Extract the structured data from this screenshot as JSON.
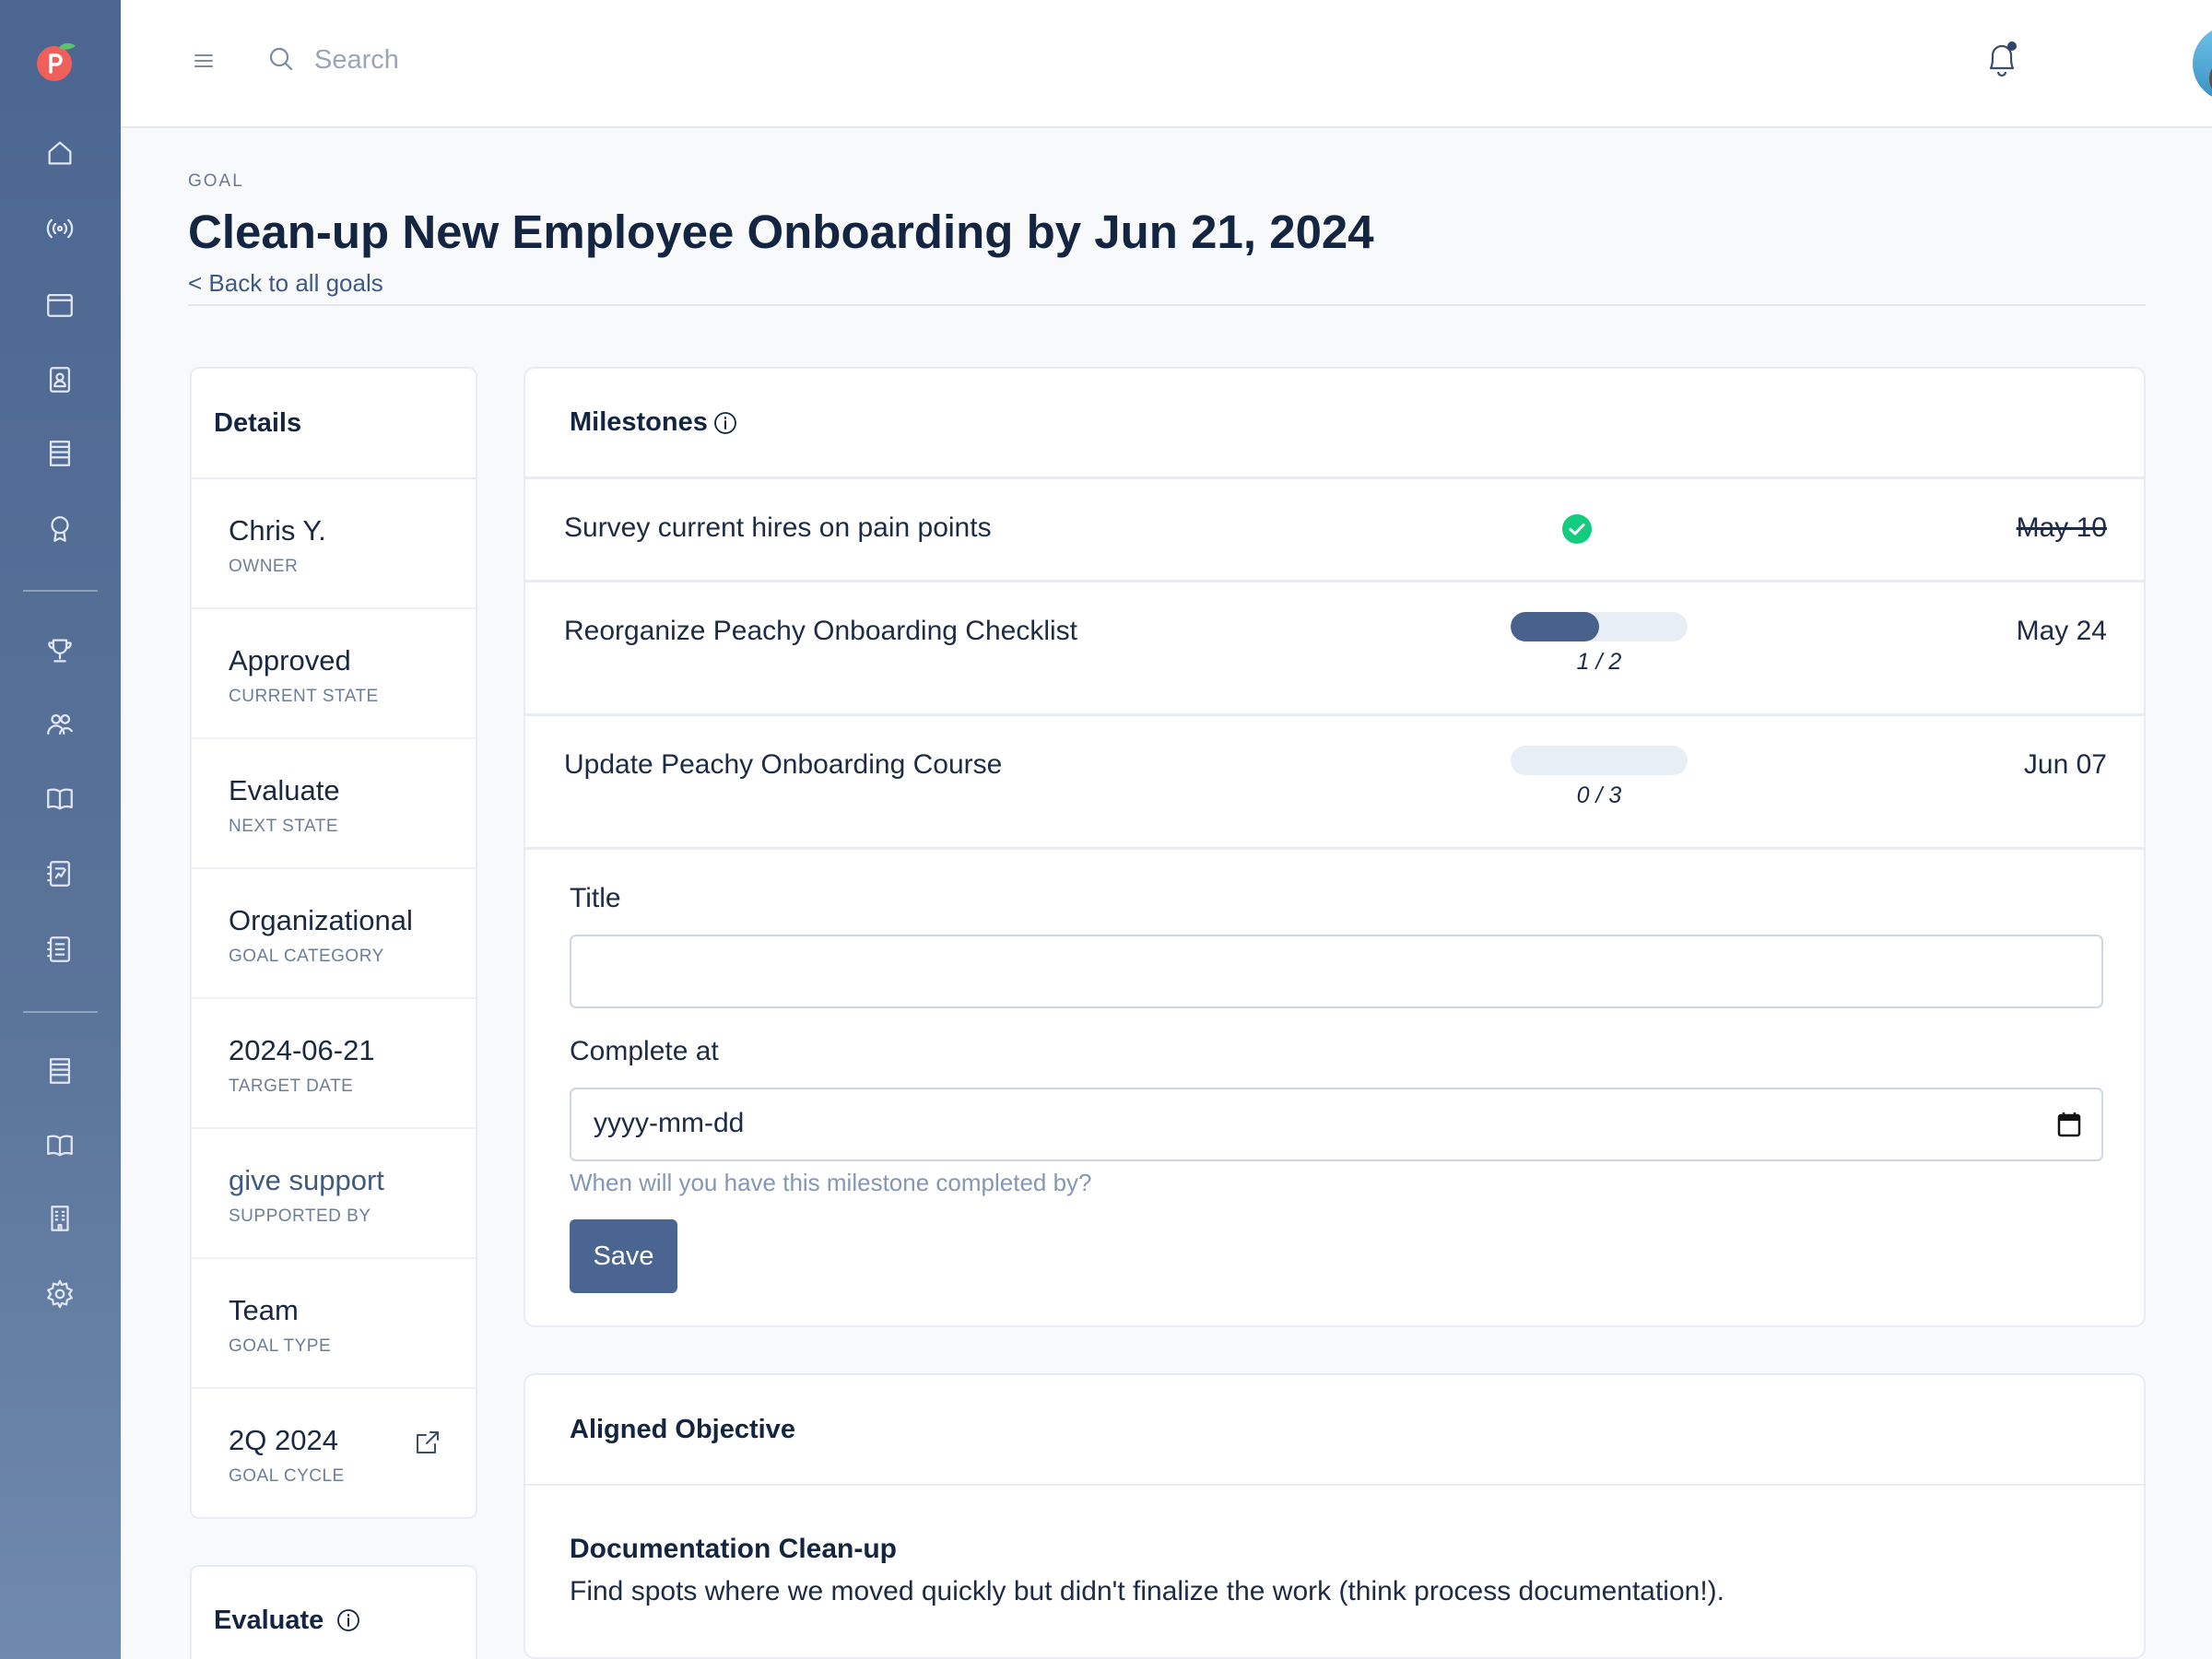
{
  "search": {
    "placeholder": "Search"
  },
  "header": {
    "eyebrow": "GOAL",
    "title": "Clean-up New Employee Onboarding by Jun 21, 2024",
    "back_link": "< Back to all goals"
  },
  "details": {
    "heading": "Details",
    "rows": [
      {
        "value": "Chris Y.",
        "label": "OWNER"
      },
      {
        "value": "Approved",
        "label": "CURRENT STATE"
      },
      {
        "value": "Evaluate",
        "label": "NEXT STATE"
      },
      {
        "value": "Organizational",
        "label": "GOAL CATEGORY"
      },
      {
        "value": "2024-06-21",
        "label": "TARGET DATE"
      },
      {
        "value": "give support",
        "label": "SUPPORTED BY"
      },
      {
        "value": "Team",
        "label": "GOAL TYPE"
      },
      {
        "value": "2Q 2024",
        "label": "GOAL CYCLE"
      }
    ]
  },
  "evaluate": {
    "heading": "Evaluate"
  },
  "milestones": {
    "heading": "Milestones",
    "items": [
      {
        "title": "Survey current hires on pain points",
        "status": "complete",
        "date": "May 10"
      },
      {
        "title": "Reorganize Peachy Onboarding Checklist",
        "progress_text": "1 / 2",
        "progress": 0.5,
        "date": "May 24"
      },
      {
        "title": "Update Peachy Onboarding Course",
        "progress_text": "0 / 3",
        "progress": 0,
        "date": "Jun 07"
      }
    ],
    "form": {
      "title_label": "Title",
      "title_value": "",
      "complete_label": "Complete at",
      "date_placeholder": "yyyy-mm-dd",
      "help": "When will you have this milestone completed by?",
      "save_label": "Save"
    }
  },
  "aligned": {
    "heading": "Aligned Objective",
    "objective_title": "Documentation Clean-up",
    "objective_desc": "Find spots where we moved quickly but didn't finalize the work (think process documentation!)."
  },
  "colors": {
    "sidebar": "#4b6691",
    "accent": "#4a6591",
    "success": "#14cc7e"
  },
  "icons": [
    "peach-logo-icon",
    "home-icon",
    "broadcast-icon",
    "calendar-icon",
    "profile-card-icon",
    "list-icon",
    "award-icon",
    "trophy-icon",
    "people-icon",
    "book-icon",
    "report-icon",
    "notes-icon",
    "list-icon",
    "book-icon",
    "building-icon",
    "gear-icon",
    "menu-icon",
    "search-icon",
    "bell-icon"
  ]
}
